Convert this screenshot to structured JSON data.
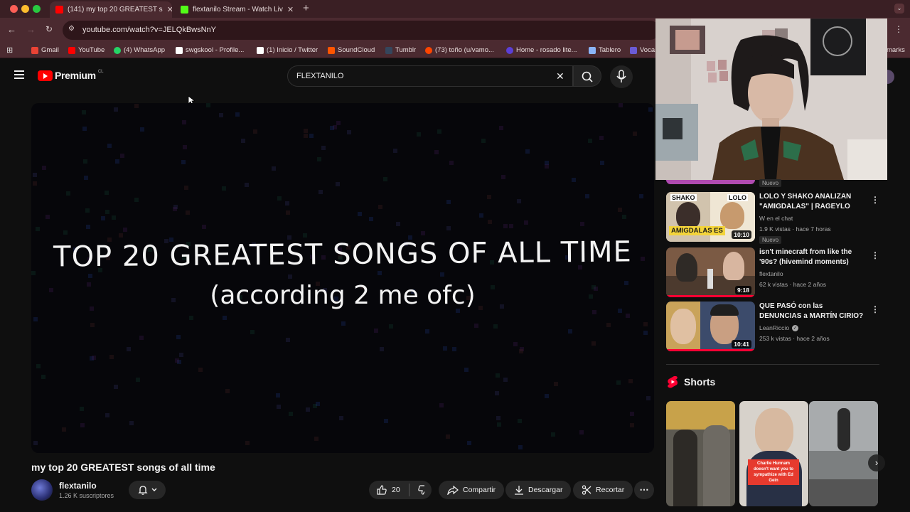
{
  "browser": {
    "tabs": [
      {
        "title": "(141) my top 20 GREATEST s",
        "active": true
      },
      {
        "title": "flextanilo Stream - Watch Liv",
        "active": false
      }
    ],
    "new_tab": "+",
    "url": "youtube.com/watch?v=JELQkBwsNnY",
    "bookmarks": [
      {
        "label": "Gmail",
        "icon": "gmail-icon",
        "color": "#ea4335"
      },
      {
        "label": "YouTube",
        "icon": "youtube-icon",
        "color": "#ff0000"
      },
      {
        "label": "(4) WhatsApp",
        "icon": "whatsapp-icon",
        "color": "#25d366"
      },
      {
        "label": "swgskool - Profile...",
        "icon": "letter-a-icon",
        "color": "#ffffff"
      },
      {
        "label": "(1) Inicio / Twitter",
        "icon": "x-icon",
        "color": "#ffffff"
      },
      {
        "label": "SoundCloud",
        "icon": "soundcloud-icon",
        "color": "#ff5500"
      },
      {
        "label": "Tumblr",
        "icon": "tumblr-icon",
        "color": "#35465c"
      },
      {
        "label": "(73) toño (u/vamo...",
        "icon": "reddit-icon",
        "color": "#ff4500"
      },
      {
        "label": "Home - rosado lite...",
        "icon": "circle-icon",
        "color": "#5b3fd6"
      },
      {
        "label": "Tablero",
        "icon": "tablero-icon",
        "color": "#8ab4f8"
      },
      {
        "label": "Voca",
        "icon": "letter-v-icon",
        "color": "#6b5bd6"
      }
    ],
    "bookmarks_overflow": "marks"
  },
  "youtube": {
    "logo_text": "Premium",
    "logo_region": "CL",
    "search_value": "FLEXTANILO"
  },
  "video": {
    "overlay_line1": "TOP 20 GREATEST SONGS OF ALL TIME",
    "overlay_line2": "(according 2 me ofc)",
    "title": "my top 20 GREATEST songs of all time",
    "channel": "flextanilo",
    "subscribers": "1.26 K suscriptores",
    "likes": "20",
    "share": "Compartir",
    "download": "Descargar",
    "clip": "Recortar"
  },
  "recommendations": [
    {
      "title": "LOLO Y SHAKO ANALIZAN \"AMIGDALAS\" | RAGEYLO",
      "channel": "W en el chat",
      "meta": "1.9 K vistas · hace 7 horas",
      "badge": "Nuevo",
      "duration": "10:10",
      "thumb_text": "AMIGDALAS ES",
      "thumb_labels": [
        "SHAKO",
        "LOLO"
      ]
    },
    {
      "title": "isn't minecraft from like the '90s? (hivemind moments)",
      "channel": "flextanilo",
      "meta": "62 k vistas · hace 2 años",
      "duration": "9:18"
    },
    {
      "title": "QUE PASÓ con las DENUNCIAS a MARTÍN CIRIO?",
      "channel": "LeanRiccio",
      "meta": "253 k vistas · hace 2 años",
      "duration": "10:41",
      "verified": true
    }
  ],
  "prev_badge": "Nuevo",
  "shorts": {
    "label": "Shorts",
    "items": [
      {
        "caption": ""
      },
      {
        "caption": "Charlie Hunnam doesn't want you to sympathize with Ed Gein"
      },
      {
        "caption": ""
      }
    ]
  }
}
